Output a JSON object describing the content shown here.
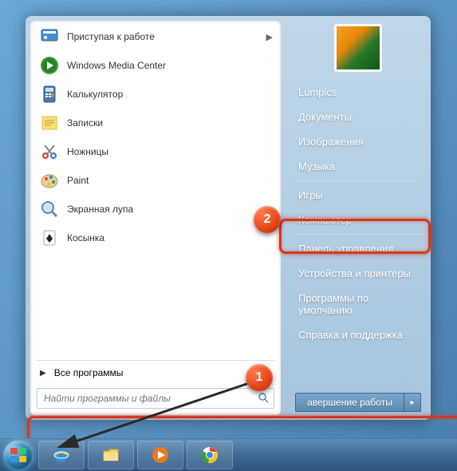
{
  "programs": [
    {
      "label": "Приступая к работе",
      "icon": "flag",
      "has_submenu": true
    },
    {
      "label": "Windows Media Center",
      "icon": "wmc"
    },
    {
      "label": "Калькулятор",
      "icon": "calc"
    },
    {
      "label": "Записки",
      "icon": "sticky"
    },
    {
      "label": "Ножницы",
      "icon": "scissors"
    },
    {
      "label": "Paint",
      "icon": "paint"
    },
    {
      "label": "Экранная лупа",
      "icon": "magnify"
    },
    {
      "label": "Косынка",
      "icon": "solitaire"
    }
  ],
  "all_programs": "Все программы",
  "search_placeholder": "Найти программы и файлы",
  "right_items_top": [
    "Lumpics",
    "Документы",
    "Изображения",
    "Музыка"
  ],
  "right_items_mid": [
    "Игры",
    "Компьютер"
  ],
  "right_items_bot": [
    "Панель управления",
    "Устройства и принтеры",
    "Программы по умолчанию",
    "Справка и поддержка"
  ],
  "shutdown": "авершение работы",
  "callouts": {
    "1": "1",
    "2": "2"
  }
}
